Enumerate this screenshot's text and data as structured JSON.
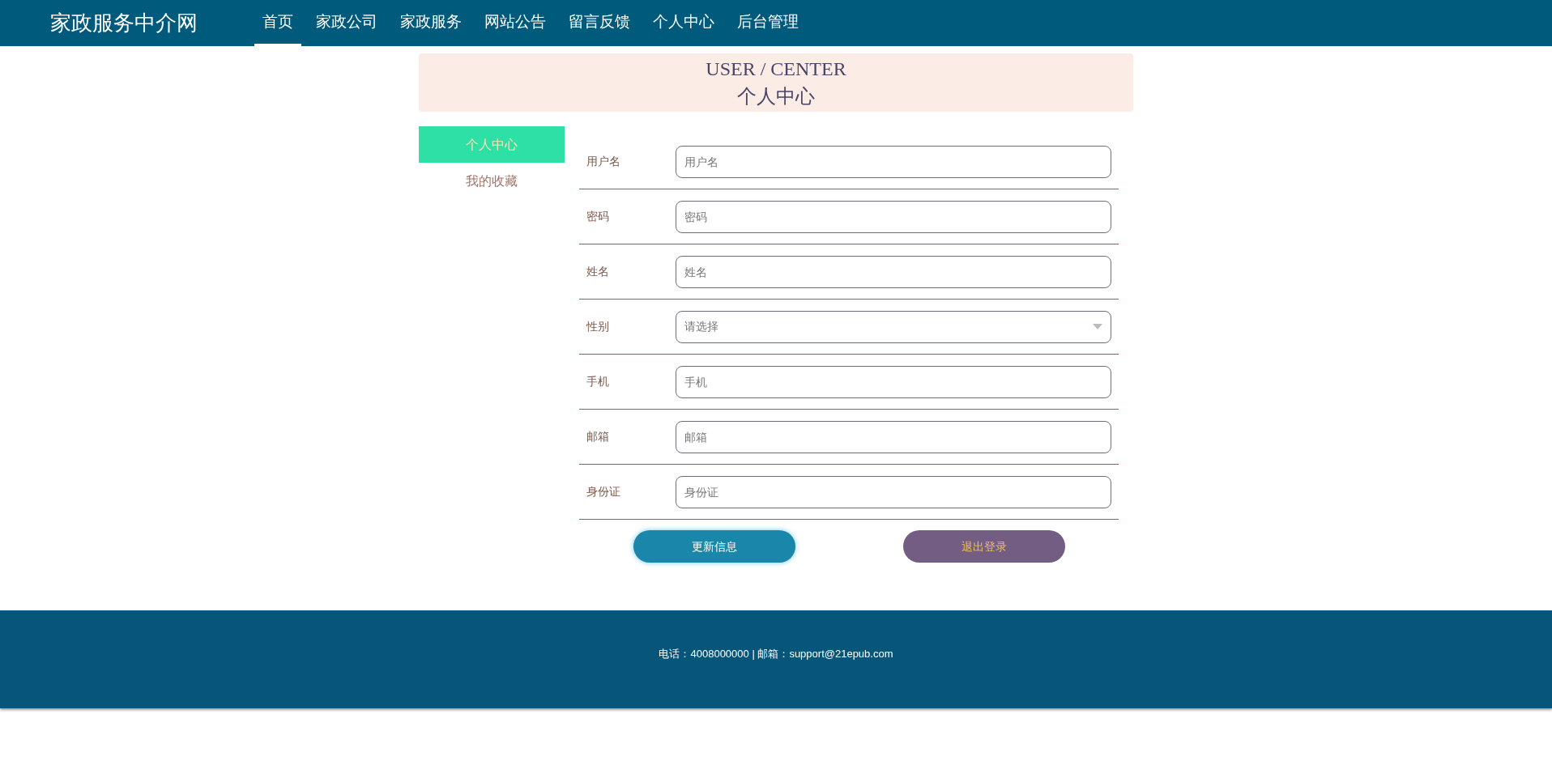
{
  "header": {
    "logo": "家政服务中介网",
    "nav": [
      {
        "label": "首页",
        "selected": true
      },
      {
        "label": "家政公司",
        "selected": false
      },
      {
        "label": "家政服务",
        "selected": false
      },
      {
        "label": "网站公告",
        "selected": false
      },
      {
        "label": "留言反馈",
        "selected": false
      },
      {
        "label": "个人中心",
        "selected": false
      },
      {
        "label": "后台管理",
        "selected": false
      }
    ]
  },
  "banner": {
    "title_en": "USER / CENTER",
    "title_zh": "个人中心"
  },
  "sidebar": {
    "items": [
      {
        "label": "个人中心",
        "selected": true
      },
      {
        "label": "我的收藏",
        "selected": false
      }
    ]
  },
  "form": {
    "fields": [
      {
        "kind": "input",
        "label": "用户名",
        "placeholder": "用户名"
      },
      {
        "kind": "input",
        "label": "密码",
        "placeholder": "密码"
      },
      {
        "kind": "input",
        "label": "姓名",
        "placeholder": "姓名"
      },
      {
        "kind": "select",
        "label": "性别",
        "placeholder": "请选择"
      },
      {
        "kind": "input",
        "label": "手机",
        "placeholder": "手机"
      },
      {
        "kind": "input",
        "label": "邮箱",
        "placeholder": "邮箱"
      },
      {
        "kind": "input",
        "label": "身份证",
        "placeholder": "身份证"
      }
    ],
    "buttons": [
      {
        "kind": "update",
        "label": "更新信息"
      },
      {
        "kind": "logout",
        "label": "退出登录"
      }
    ]
  },
  "footer": {
    "text": "电话：4008000000 | 邮箱：support@21epub.com"
  }
}
